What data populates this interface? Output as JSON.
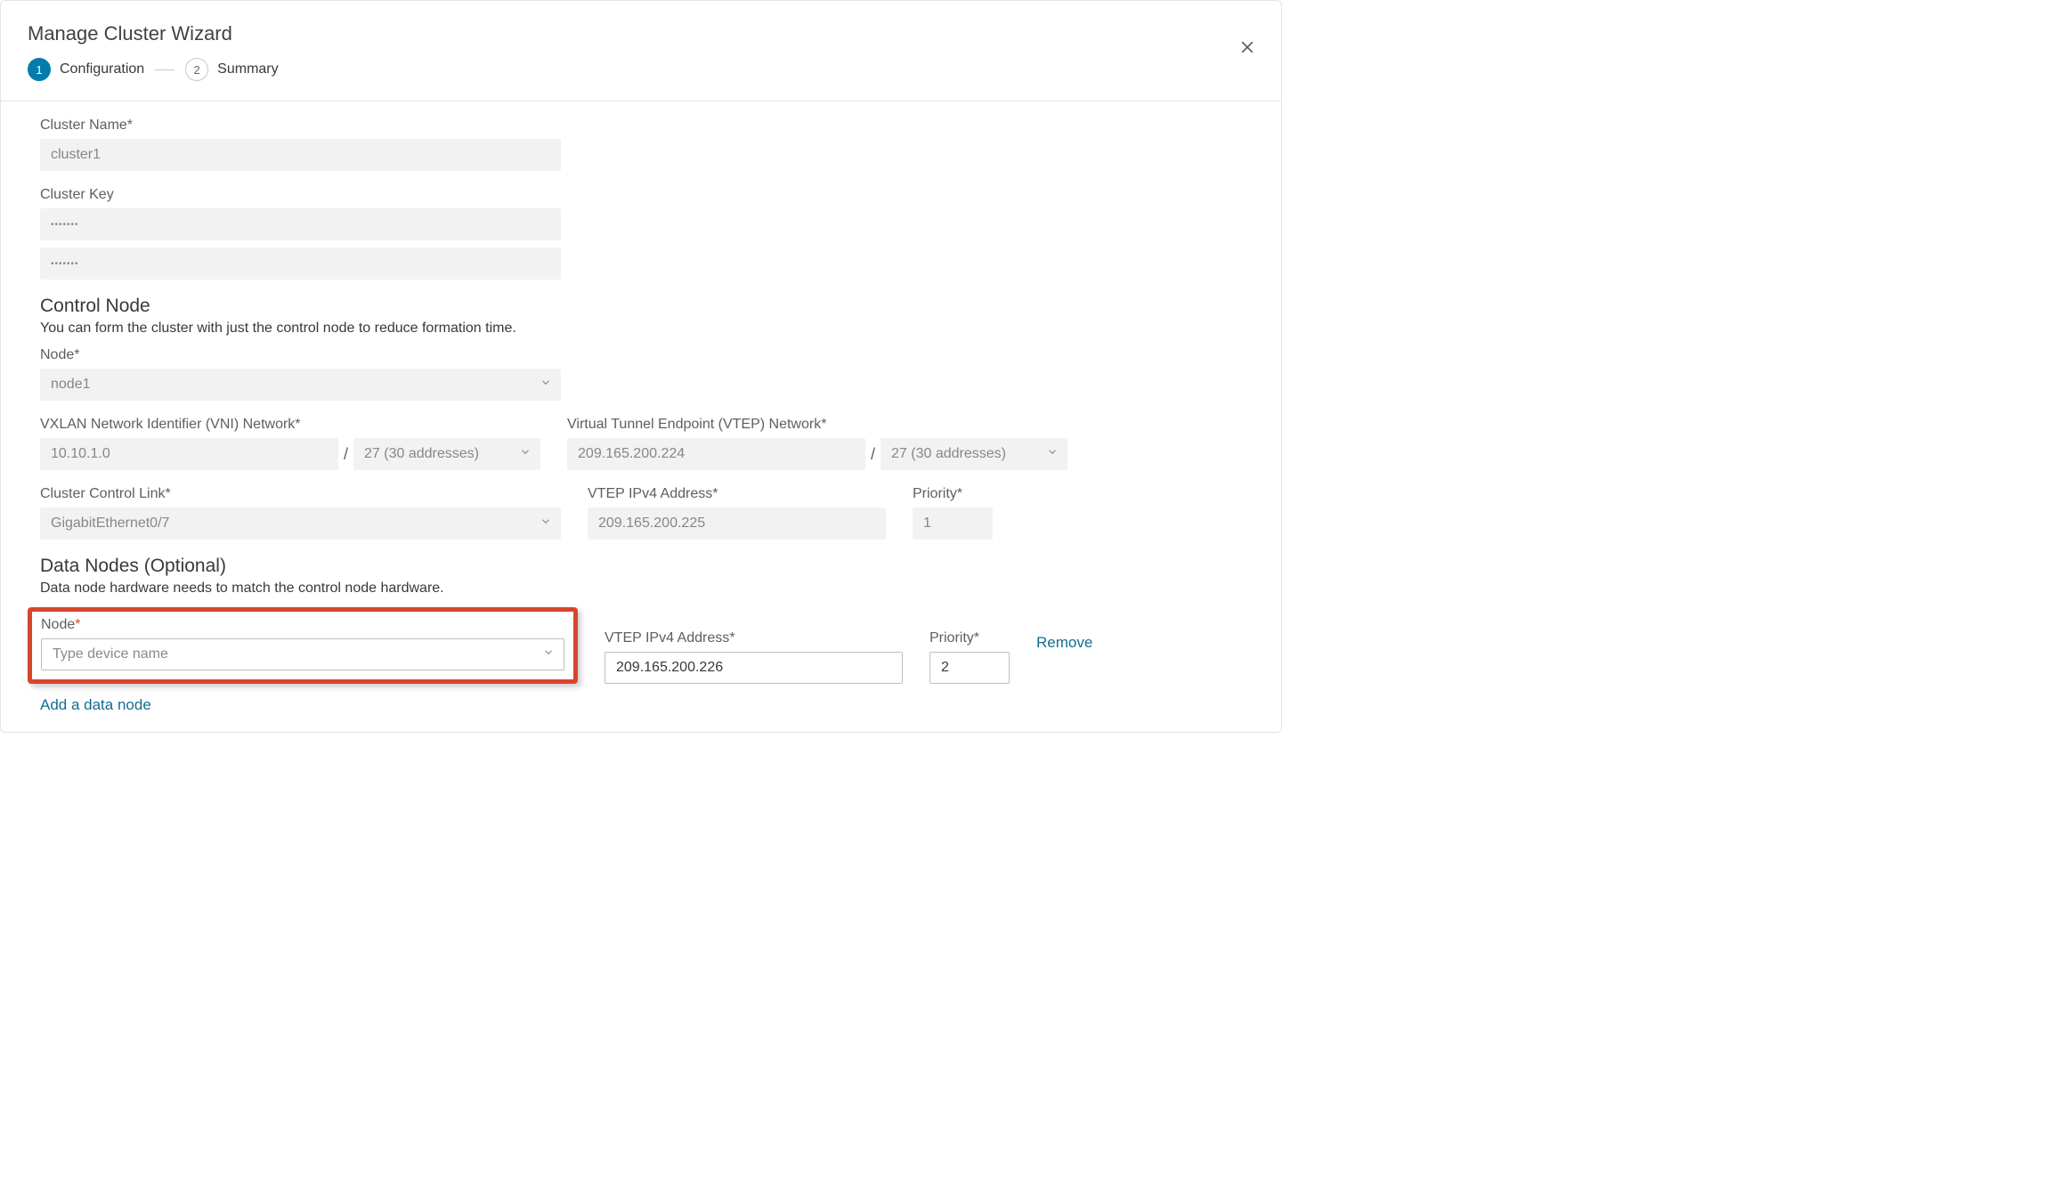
{
  "header": {
    "title": "Manage Cluster Wizard",
    "step1_num": "1",
    "step1_label": "Configuration",
    "step2_num": "2",
    "step2_label": "Summary"
  },
  "cluster": {
    "name_label": "Cluster Name*",
    "name_value": "cluster1",
    "key_label": "Cluster Key",
    "key_value1": "•••••••",
    "key_value2": "•••••••"
  },
  "control": {
    "section_title": "Control Node",
    "section_sub": "You can form the cluster with just the control node to reduce formation time.",
    "node_label": "Node*",
    "node_value": "node1",
    "vni_label": "VXLAN Network Identifier (VNI) Network*",
    "vni_value": "10.10.1.0",
    "vni_mask": "27 (30 addresses)",
    "vtep_net_label": "Virtual Tunnel Endpoint (VTEP) Network*",
    "vtep_net_value": "209.165.200.224",
    "vtep_net_mask": "27 (30 addresses)",
    "ccl_label": "Cluster Control Link*",
    "ccl_value": "GigabitEthernet0/7",
    "vtep_addr_label": "VTEP IPv4 Address*",
    "vtep_addr_value": "209.165.200.225",
    "priority_label": "Priority*",
    "priority_value": "1"
  },
  "datanodes": {
    "section_title": "Data Nodes (Optional)",
    "section_sub": "Data node hardware needs to match the control node hardware.",
    "node_label": "Node",
    "node_placeholder": "Type device name",
    "vtep_addr_label": "VTEP IPv4 Address*",
    "vtep_addr_value": "209.165.200.226",
    "priority_label": "Priority*",
    "priority_value": "2",
    "remove_label": "Remove",
    "add_label": "Add a data node"
  }
}
